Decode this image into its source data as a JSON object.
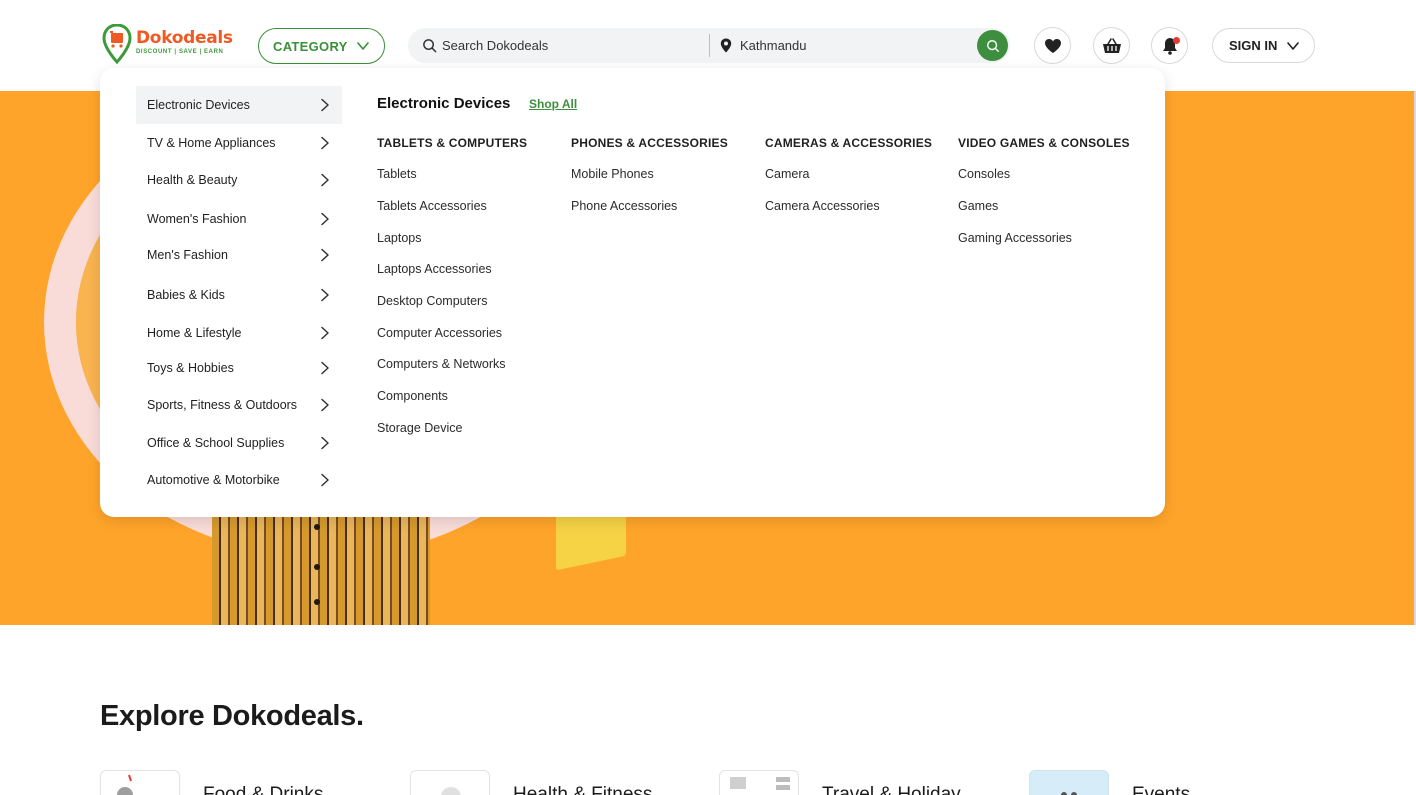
{
  "header": {
    "logo": {
      "word": "Dokodeals",
      "tagline": "DISCOUNT | SAVE | EARN"
    },
    "category_label": "CATEGORY",
    "search": {
      "placeholder": "Search Dokodeals",
      "location": "Kathmandu"
    },
    "signin_label": "SIGN IN",
    "icons": [
      "heart-icon",
      "basket-icon",
      "bell-icon"
    ],
    "notification_dot": true,
    "colors": {
      "brand_green": "#3d8f3f",
      "brand_orange": "#ef5a24"
    }
  },
  "menu": {
    "categories": [
      {
        "label": "Electronic Devices",
        "active": true
      },
      {
        "label": "TV & Home Appliances"
      },
      {
        "label": "Health & Beauty"
      },
      {
        "label": "Women's Fashion"
      },
      {
        "label": "Men's Fashion"
      },
      {
        "label": "Babies & Kids"
      },
      {
        "label": "Home & Lifestyle"
      },
      {
        "label": "Toys & Hobbies"
      },
      {
        "label": "Sports, Fitness & Outdoors"
      },
      {
        "label": "Office & School Supplies"
      },
      {
        "label": "Automotive & Motorbike"
      }
    ],
    "selected_heading": "Electronic Devices",
    "shop_all": "Shop All",
    "columns": [
      {
        "title": "TABLETS & COMPUTERS",
        "links": [
          "Tablets",
          "Tablets Accessories",
          "Laptops",
          "Laptops Accessories",
          "Desktop Computers",
          "Computer Accessories",
          "Computers & Networks",
          "Components",
          "Storage Device"
        ]
      },
      {
        "title": "PHONES & ACCESSORIES",
        "links": [
          "Mobile Phones",
          "Phone Accessories"
        ]
      },
      {
        "title": "CAMERAS & ACCESSORIES",
        "links": [
          "Camera",
          "Camera Accessories"
        ]
      },
      {
        "title": "VIDEO GAMES & CONSOLES",
        "links": [
          "Consoles",
          "Games",
          "Gaming Accessories"
        ]
      }
    ]
  },
  "hero": {
    "background": "#ffa42a"
  },
  "explore": {
    "title": "Explore Dokodeals.",
    "tiles": [
      {
        "label": "Food & Drinks"
      },
      {
        "label": "Health & Fitness"
      },
      {
        "label": "Travel & Holiday"
      },
      {
        "label": "Events"
      }
    ]
  }
}
